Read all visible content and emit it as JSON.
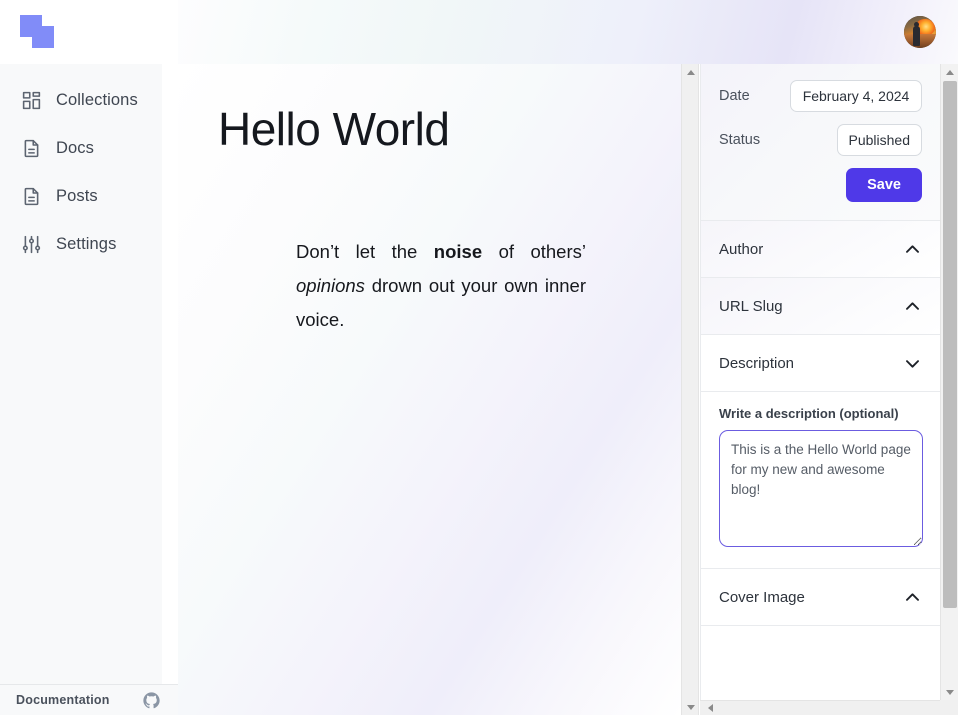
{
  "brand": {
    "logo_name": "overlapping-squares-logo",
    "accent_color": "#4f39e8",
    "logo_color": "#818cf8"
  },
  "topbar": {
    "avatar_alt": "user-avatar"
  },
  "sidebar": {
    "items": [
      {
        "label": "Collections",
        "icon": "grid-icon"
      },
      {
        "label": "Docs",
        "icon": "document-icon"
      },
      {
        "label": "Posts",
        "icon": "document-icon"
      },
      {
        "label": "Settings",
        "icon": "sliders-icon"
      }
    ],
    "footer": {
      "label": "Documentation",
      "icon": "github-icon"
    }
  },
  "main": {
    "title": "Hello World",
    "paragraph": {
      "part1": "Don’t let the ",
      "bold": "noise",
      "part2": " of others’ ",
      "italic": "opinions",
      "part3": " drown out your own inner voice."
    }
  },
  "right_panel": {
    "meta": {
      "date_label": "Date",
      "date_value": "February 4, 2024",
      "status_label": "Status",
      "status_value": "Published",
      "save_label": "Save"
    },
    "sections": [
      {
        "title": "Author",
        "chevron": "chevron-up-icon",
        "expanded": false
      },
      {
        "title": "URL Slug",
        "chevron": "chevron-up-icon",
        "expanded": false
      },
      {
        "title": "Description",
        "chevron": "chevron-down-icon",
        "expanded": true
      },
      {
        "title": "Cover Image",
        "chevron": "chevron-up-icon",
        "expanded": false
      }
    ],
    "description": {
      "field_label": "Write a description (optional)",
      "value": "This is a the Hello World page for my new and awesome blog!",
      "placeholder": "Write a description (optional)"
    }
  }
}
